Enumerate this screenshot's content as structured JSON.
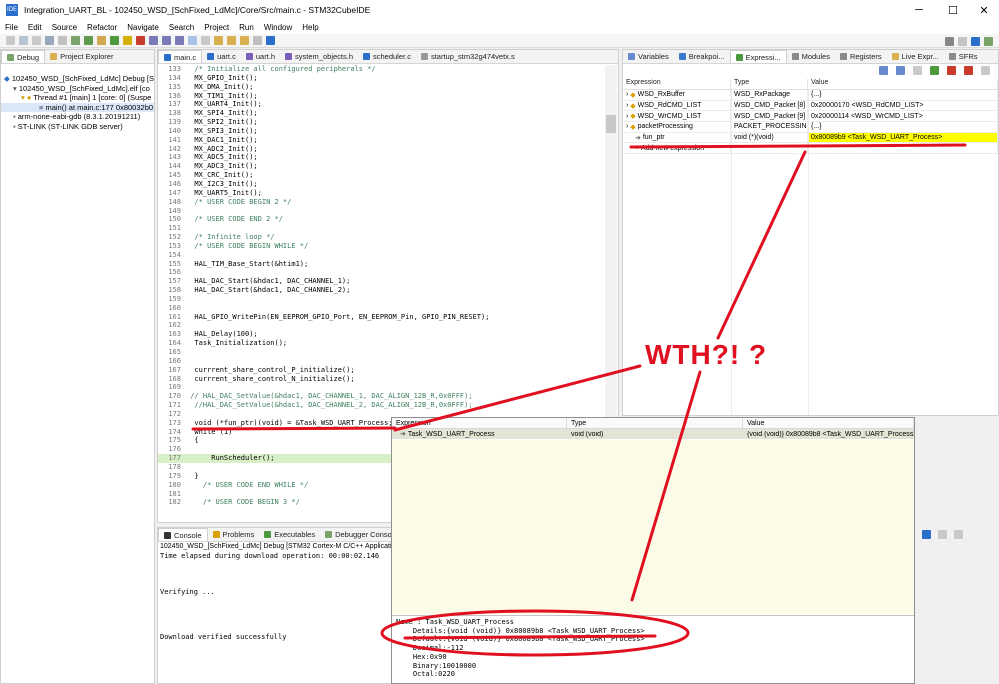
{
  "window": {
    "title": "Integration_UART_BL - 102450_WSD_[SchFixed_LdMc]/Core/Src/main.c - STM32CubeIDE",
    "app_icon_text": "IDE",
    "minimize": "─",
    "maximize": "☐",
    "close": "✕"
  },
  "menu": [
    "File",
    "Edit",
    "Source",
    "Refactor",
    "Navigate",
    "Search",
    "Project",
    "Run",
    "Window",
    "Help"
  ],
  "colors": {
    "accent": "#2a6fcb",
    "annotation": "#e01020",
    "highlight_yellow": "#ffff00",
    "popup_bg": "#fbfbe8"
  },
  "debug_panel": {
    "tabs": [
      "Debug",
      "Project Explorer"
    ],
    "tree": [
      "102450_WSD_[SchFixed_LdMc] Debug [ST",
      "102450_WSD_[SchFixed_LdMc].elf [co",
      "Thread #1 [main] 1 [core: 0] (Suspe",
      "main() at main.c:177 0x80032b0",
      "arm-none-eabi-gdb (8.3.1.20191211)",
      "ST-LINK (ST-LINK GDB server)"
    ]
  },
  "editor": {
    "tabs": [
      "main.c",
      "uart.c",
      "uart.h",
      "system_objects.h",
      "scheduler.c",
      "startup_stm32g474vetx.s"
    ],
    "lines": [
      {
        "n": "133",
        "t": "  /* Initialize all configured peripherals */",
        "c": "cmt"
      },
      {
        "n": "134",
        "t": "  MX_GPIO_Init();"
      },
      {
        "n": "135",
        "t": "  MX_DMA_Init();"
      },
      {
        "n": "136",
        "t": "  MX_TIM1_Init();"
      },
      {
        "n": "137",
        "t": "  MX_UART4_Init();"
      },
      {
        "n": "138",
        "t": "  MX_SPI4_Init();"
      },
      {
        "n": "139",
        "t": "  MX_SPI2_Init();"
      },
      {
        "n": "140",
        "t": "  MX_SPI3_Init();"
      },
      {
        "n": "141",
        "t": "  MX_DAC1_Init();"
      },
      {
        "n": "142",
        "t": "  MX_ADC2_Init();"
      },
      {
        "n": "143",
        "t": "  MX_ADC5_Init();"
      },
      {
        "n": "144",
        "t": "  MX_ADC3_Init();"
      },
      {
        "n": "145",
        "t": "  MX_CRC_Init();"
      },
      {
        "n": "146",
        "t": "  MX_I2C3_Init();"
      },
      {
        "n": "147",
        "t": "  MX_UART5_Init();"
      },
      {
        "n": "148",
        "t": "  /* USER CODE BEGIN 2 */",
        "c": "cmt"
      },
      {
        "n": "149",
        "t": ""
      },
      {
        "n": "150",
        "t": "  /* USER CODE END 2 */",
        "c": "cmt"
      },
      {
        "n": "151",
        "t": ""
      },
      {
        "n": "152",
        "t": "  /* Infinite loop */",
        "c": "cmt"
      },
      {
        "n": "153",
        "t": "  /* USER CODE BEGIN WHILE */",
        "c": "cmt"
      },
      {
        "n": "154",
        "t": ""
      },
      {
        "n": "155",
        "t": "  HAL_TIM_Base_Start(&htim1);"
      },
      {
        "n": "156",
        "t": ""
      },
      {
        "n": "157",
        "t": "  HAL_DAC_Start(&hdac1, DAC_CHANNEL_1);"
      },
      {
        "n": "158",
        "t": "  HAL_DAC_Start(&hdac1, DAC_CHANNEL_2);"
      },
      {
        "n": "159",
        "t": ""
      },
      {
        "n": "160",
        "t": ""
      },
      {
        "n": "161",
        "t": "  HAL_GPIO_WritePin(EN_EEPROM_GPIO_Port, EN_EEPROM_Pin, GPIO_PIN_RESET);"
      },
      {
        "n": "162",
        "t": ""
      },
      {
        "n": "163",
        "t": "  HAL_Delay(100);"
      },
      {
        "n": "164",
        "t": "  Task_Initialization();"
      },
      {
        "n": "165",
        "t": ""
      },
      {
        "n": "166",
        "t": ""
      },
      {
        "n": "167",
        "t": "  currrent_share_control_P_initialize();"
      },
      {
        "n": "168",
        "t": "  currrent_share_control_N_initialize();"
      },
      {
        "n": "169",
        "t": ""
      },
      {
        "n": "170",
        "t": " // HAL_DAC_SetValue(&hdac1, DAC_CHANNEL_1, DAC_ALIGN_12B_R,0x0FFF);",
        "c": "cmt"
      },
      {
        "n": "171",
        "t": "  //HAL_DAC_SetValue(&hdac1, DAC_CHANNEL_2, DAC_ALIGN_12B_R,0x0FFF);",
        "c": "cmt"
      },
      {
        "n": "172",
        "t": ""
      },
      {
        "n": "173",
        "t": "  void (*fun_ptr)(void) = &Task_WSD_UART_Process;"
      },
      {
        "n": "174",
        "t": "  while (1)"
      },
      {
        "n": "175",
        "t": "  {"
      },
      {
        "n": "176",
        "t": ""
      },
      {
        "n": "177",
        "t": "      RunScheduler();"
      },
      {
        "n": "178",
        "t": ""
      },
      {
        "n": "179",
        "t": "  }"
      },
      {
        "n": "180",
        "t": "    /* USER CODE END WHILE */",
        "c": "cmt"
      },
      {
        "n": "181",
        "t": ""
      },
      {
        "n": "182",
        "t": "    /* USER CODE BEGIN 3 */",
        "c": "cmt"
      }
    ]
  },
  "right_panel": {
    "tabs": [
      "Variables",
      "Breakpoi...",
      "Expressi...",
      "Modules",
      "Registers",
      "Live Expr...",
      "SFRs"
    ],
    "columns": [
      "Expression",
      "Type",
      "Value"
    ],
    "rows": [
      {
        "expr": "WSD_RxBuffer",
        "type": "WSD_RxPackage",
        "value": "{...}"
      },
      {
        "expr": "WSD_RdCMD_LIST",
        "type": "WSD_CMD_Packet [8]",
        "value": "0x20000170 <WSD_RdCMD_LIST>"
      },
      {
        "expr": "WSD_WrCMD_LIST",
        "type": "WSD_CMD_Packet [9]",
        "value": "0x20000114 <WSD_WrCMD_LIST>"
      },
      {
        "expr": "packetProcessing",
        "type": "PACKET_PROCESSING",
        "value": "{...}"
      },
      {
        "expr": "fun_ptr",
        "type": "void (*)(void)",
        "value": "0x80089b9 <Task_WSD_UART_Process>"
      },
      {
        "expr": "Add new expression",
        "type": "",
        "value": ""
      }
    ]
  },
  "popup": {
    "columns": [
      "Expression",
      "Type",
      "Value"
    ],
    "row": {
      "expr": "Task_WSD_UART_Process",
      "type": "void (void)",
      "value": "{void (void)} 0x80089b8 <Task_WSD_UART_Process>"
    },
    "details": "Name : Task_WSD_UART_Process\n    Details:{void (void)} 0x80089b8 <Task_WSD_UART_Process>\n    Default:{void (void)} 0x80089b8 <Task_WSD_UART_Process>\n    Decimal:-112\n    Hex:0x90\n    Binary:10010000\n    Octal:0220"
  },
  "console": {
    "tabs": [
      "Console",
      "Problems",
      "Executables",
      "Debugger Console"
    ],
    "header": "102450_WSD_[SchFixed_LdMc] Debug [STM32 Cortex-M C/C++ Applicatio",
    "body": "Time elapsed during download operation: 00:00:02.146\n\n\n\nVerifying ...\n\n\n\n\nDownload verified successfully"
  },
  "annotation": {
    "text": "WTH?! ?"
  }
}
